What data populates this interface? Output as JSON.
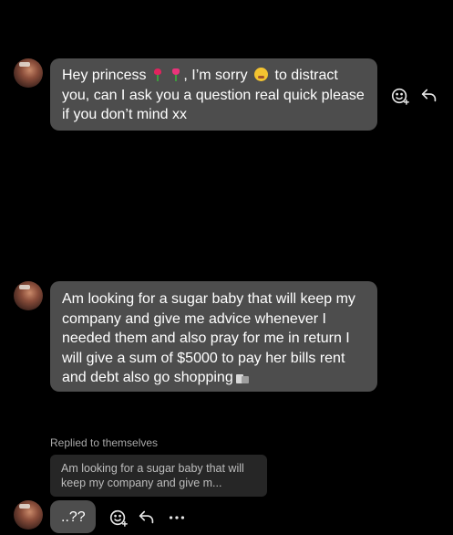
{
  "messages": [
    {
      "sender_avatar": "avatar",
      "parts": [
        "Hey princess ",
        " ",
        ", I’m sorry ",
        " to distract you, can I ask you a question real quick please if you don’t mind xx"
      ],
      "emojis": [
        "rose-emoji",
        "tulip-emoji",
        "grimace-face-emoji"
      ]
    },
    {
      "sender_avatar": "avatar",
      "text": "Am looking for a sugar baby that will keep my company and give me advice whenever I needed them and also pray for me in return I will give a sum of $5000 to pay her bills rent and debt also go shopping",
      "emojis": [
        "shopping-bags-emoji"
      ]
    },
    {
      "sender_avatar": "avatar",
      "reply_label": "Replied to themselves",
      "reply_preview": "Am looking for a sugar baby that will keep my company and give m...",
      "text": "..??"
    }
  ],
  "actions": {
    "react_icon": "smiley-plus-icon",
    "reply_icon": "reply-arrow-icon",
    "more_icon": "more-dots-icon"
  },
  "colors": {
    "background": "#000000",
    "bubble": "#4d4d4d",
    "reply_preview_bg": "#262626",
    "secondary_text": "#a8a8a8"
  }
}
